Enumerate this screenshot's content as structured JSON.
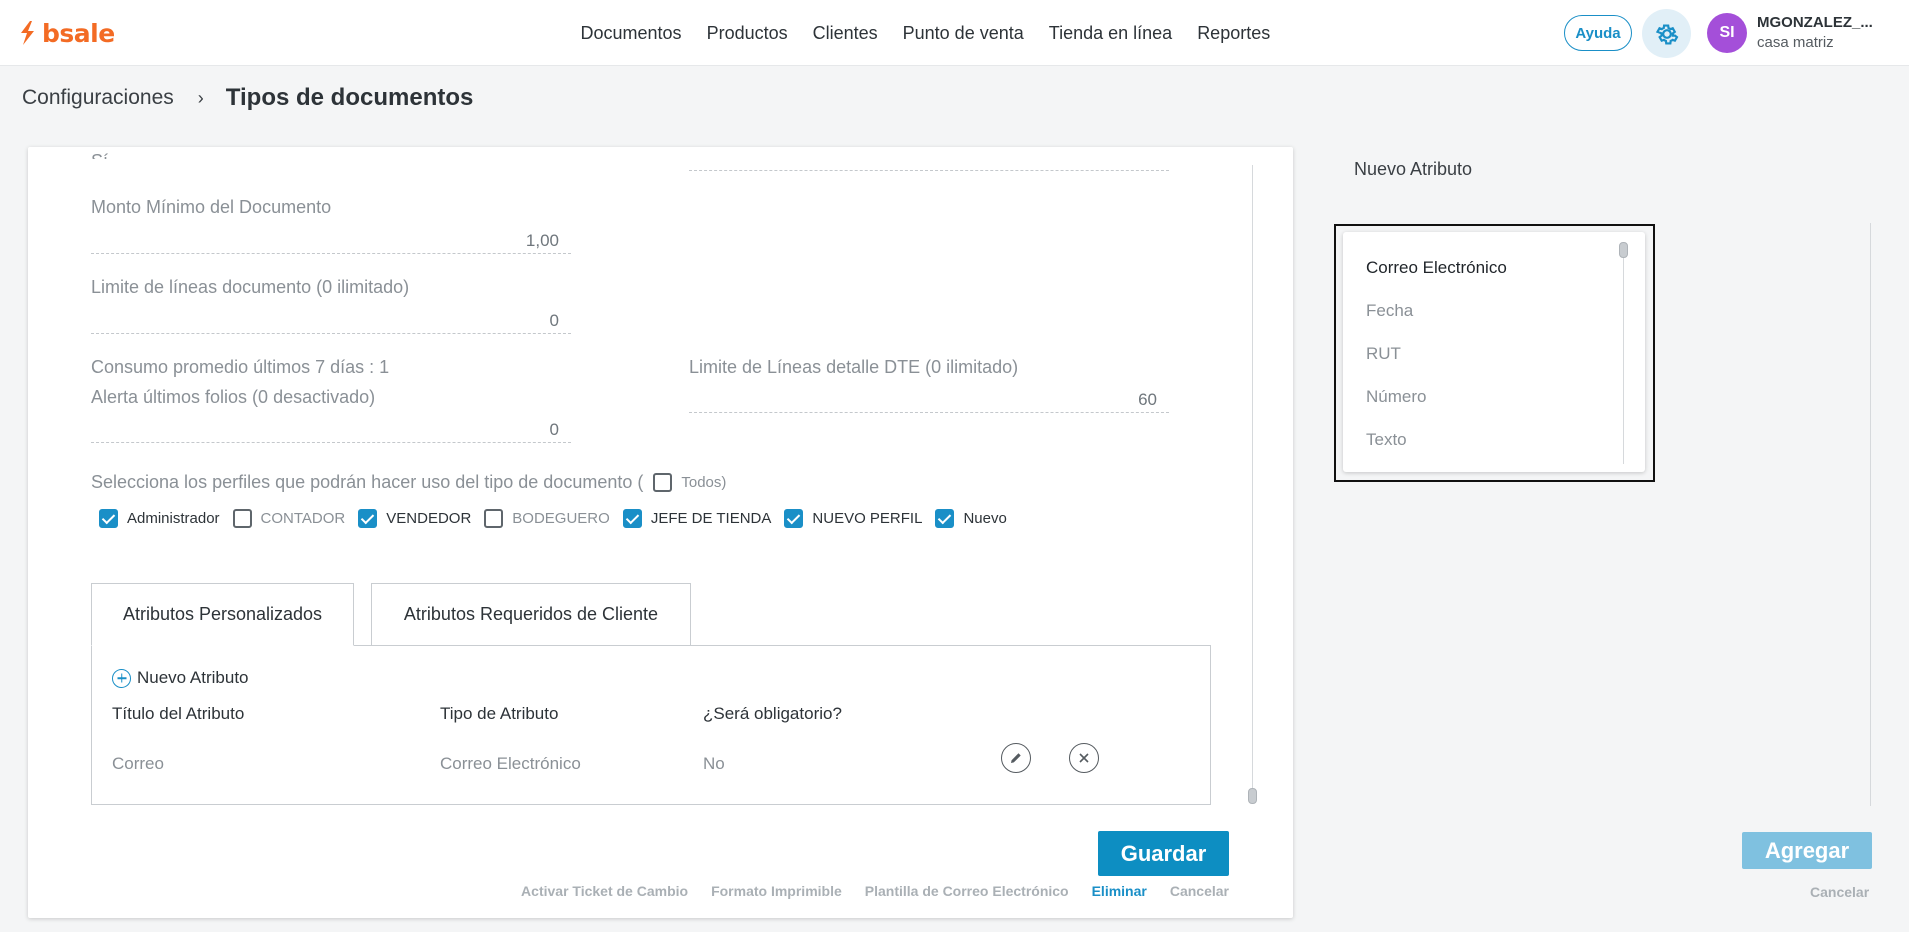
{
  "app": {
    "logo_text": "bsale",
    "colors": {
      "brand": "#f36b24",
      "accent": "#0d8ec2",
      "avatar": "#a44fd9"
    }
  },
  "nav": {
    "items": [
      "Documentos",
      "Productos",
      "Clientes",
      "Punto de venta",
      "Tienda en línea",
      "Reportes"
    ],
    "help_label": "Ayuda",
    "settings_icon": "gear-icon"
  },
  "user": {
    "initials": "SI",
    "name": "MGONZALEZ_...",
    "branch": "casa matriz"
  },
  "breadcrumb": {
    "parent": "Configuraciones",
    "separator": "›",
    "current": "Tipos de documentos"
  },
  "form": {
    "cut_label": "",
    "min_amount": {
      "label": "Monto Mínimo del Documento",
      "value": "1,00"
    },
    "line_limit": {
      "label": "Limite de líneas documento (0 ilimitado)",
      "value": "0"
    },
    "avg_consumption": "Consumo promedio últimos 7 días : 1",
    "folio_alert": {
      "label": "Alerta últimos folios (0 desactivado)",
      "value": "0"
    },
    "dte_line_limit": {
      "label": "Limite de Líneas detalle DTE (0 ilimitado)",
      "value": "60"
    },
    "profiles_prompt": "Selecciona los perfiles que podrán hacer uso del tipo de documento (",
    "all_label": "Todos)",
    "all_checked": false,
    "profiles": [
      {
        "label": "Administrador",
        "checked": true
      },
      {
        "label": "CONTADOR",
        "checked": false
      },
      {
        "label": "VENDEDOR",
        "checked": true
      },
      {
        "label": "BODEGUERO",
        "checked": false
      },
      {
        "label": "JEFE DE TIENDA",
        "checked": true
      },
      {
        "label": "NUEVO PERFIL",
        "checked": true
      },
      {
        "label": "Nuevo",
        "checked": true
      }
    ]
  },
  "tabs": {
    "custom": "Atributos Personalizados",
    "client": "Atributos Requeridos de Cliente"
  },
  "attributes": {
    "add_label": "Nuevo Atributo",
    "headers": [
      "Título del Atributo",
      "Tipo de Atributo",
      "¿Será obligatorio?"
    ],
    "rows": [
      {
        "title": "Correo",
        "type": "Correo Electrónico",
        "required": "No"
      }
    ]
  },
  "actions": {
    "save": "Guardar",
    "links": [
      "Activar Ticket de Cambio",
      "Formato Imprimible",
      "Plantilla de Correo Electrónico",
      "Eliminar",
      "Cancelar"
    ]
  },
  "side_panel": {
    "title": "Nuevo Atributo",
    "options": [
      "Correo Electrónico",
      "Fecha",
      "RUT",
      "Número",
      "Texto"
    ],
    "selected": "Correo Electrónico",
    "add": "Agregar",
    "cancel": "Cancelar"
  }
}
